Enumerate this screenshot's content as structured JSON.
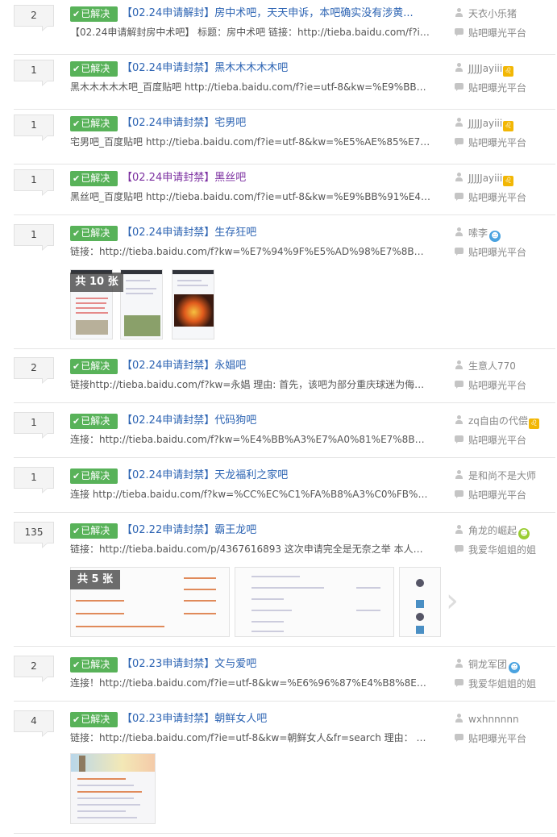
{
  "threads": [
    {
      "replies": "2",
      "badge": "已解决",
      "title": "【02.24申请解封】房中术吧，天天申诉，本吧确实没有涉黄...",
      "abstract": "【02.24申请解封房中术吧】 标题：房中术吧 链接：http://tieba.baidu.com/f?ie=utf...",
      "author": "天衣小乐猪",
      "last": "贴吧曝光平台"
    },
    {
      "replies": "1",
      "badge": "已解决",
      "title": "【02.24申请封禁】黑木木木木木吧",
      "abstract": "黑木木木木木吧_百度贴吧 http://tieba.baidu.com/f?ie=utf-8&kw=%E9%BB%91%...",
      "author": "JJJJJayiii",
      "last": "贴吧曝光平台",
      "zodiac": "♌"
    },
    {
      "replies": "1",
      "badge": "已解决",
      "title": "【02.24申请封禁】宅男吧",
      "abstract": "宅男吧_百度贴吧 http://tieba.baidu.com/f?ie=utf-8&kw=%E5%AE%85%E7%94%...",
      "author": "JJJJJayiii",
      "last": "贴吧曝光平台",
      "zodiac": "♌"
    },
    {
      "replies": "1",
      "badge": "已解决",
      "title": "【02.24申请封禁】黑丝吧",
      "abstract": "黑丝吧_百度贴吧 http://tieba.baidu.com/f?ie=utf-8&kw=%E9%BB%91%E4%B8%...",
      "author": "JJJJJayiii",
      "last": "贴吧曝光平台",
      "zodiac": "♌",
      "visited": true
    },
    {
      "replies": "1",
      "badge": "已解决",
      "title": "【02.24申请封禁】生存狂吧",
      "abstract": "链接：http://tieba.baidu.com/f?kw=%E7%94%9F%E5%AD%98%E7%8B%82 理...",
      "author": "嗦李",
      "last": "贴吧曝光平台",
      "member": "blue",
      "media": "共 10 张"
    },
    {
      "replies": "2",
      "badge": "已解决",
      "title": "【02.24申请封禁】永娼吧",
      "abstract": "链接http://tieba.baidu.com/f?kw=永娼 理由: 首先，该吧为部分重庆球迷为侮辱石家...",
      "author": "生意人770",
      "last": "贴吧曝光平台"
    },
    {
      "replies": "1",
      "badge": "已解决",
      "title": "【02.24申请封禁】代码狗吧",
      "abstract": "连接：http://tieba.baidu.com/f?kw=%E4%BB%A3%E7%A0%81%E7%8B%97&ie...",
      "author": "zq自由の代偿",
      "last": "贴吧曝光平台",
      "zodiac": "♌"
    },
    {
      "replies": "1",
      "badge": "已解决",
      "title": "【02.24申请封禁】天龙福利之家吧",
      "abstract": "连接 http://tieba.baidu.com/f?kw=%CC%EC%C1%FA%B8%A3%C0%FB%D6%...",
      "author": "是和尚不是大师",
      "last": "贴吧曝光平台"
    },
    {
      "replies": "135",
      "badge": "已解决",
      "title": "【02.22申请封禁】霸王龙吧",
      "abstract": "链接：http://tieba.baidu.com/p/4367616893 这次申请完全是无奈之举 本人原本在...",
      "author": "角龙的崛起",
      "last": "我爱华姐姐的姐",
      "member": "green",
      "media": "共 5 张"
    },
    {
      "replies": "2",
      "badge": "已解决",
      "title": "【02.23申请封禁】文与爱吧",
      "abstract": "连接！http://tieba.baidu.com/f?ie=utf-8&kw=%E6%96%87%E4%B8%8E%E7%8...",
      "author": "铜龙军团",
      "last": "我爱华姐姐的姐",
      "member": "blue"
    },
    {
      "replies": "4",
      "badge": "已解决",
      "title": "【02.23申请封禁】朝鲜女人吧",
      "abstract": "链接：http://tieba.baidu.com/f?ie=utf-8&kw=朝鲜女人&fr=search 理由： 不知道这...",
      "author": "wxhnnnnn",
      "last": "贴吧曝光平台"
    }
  ],
  "icons": {
    "author": "person-icon",
    "last_reply": "comment-icon",
    "resolved": "check-icon",
    "next": "chevron-right-icon"
  }
}
